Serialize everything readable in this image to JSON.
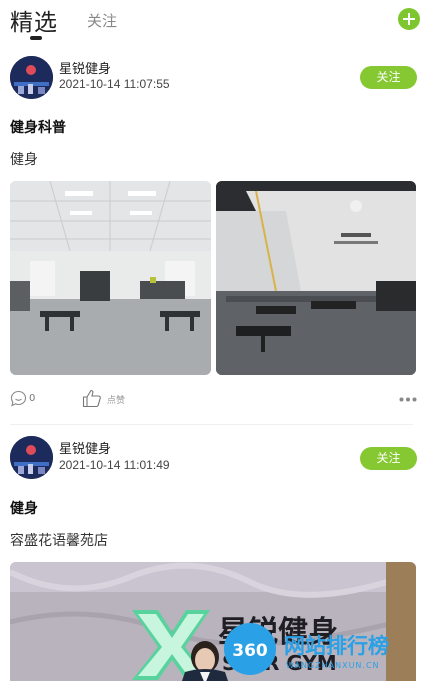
{
  "header": {
    "tab_featured": "精选",
    "tab_following": "关注",
    "add_icon": "plus-circle-icon"
  },
  "colors": {
    "accent_green": "#86c832",
    "watermark_blue": "#2aa0e6"
  },
  "posts": [
    {
      "author": "星锐健身",
      "timestamp": "2021-10-14 11:07:55",
      "follow_label": "关注",
      "title": "健身科普",
      "text": "健身",
      "comment_count": "0",
      "like_label": "点赞"
    },
    {
      "author": "星锐健身",
      "timestamp": "2021-10-14 11:01:49",
      "follow_label": "关注",
      "title": "健身",
      "text": "容盛花语馨苑店",
      "image_text": "星锐健身",
      "image_subtext": "STAR GYM",
      "logo_text": "XR"
    }
  ],
  "watermark": {
    "logo_number": "360",
    "site_name": "网站排行榜",
    "site_url": "WANGZHANXUN.CN"
  }
}
